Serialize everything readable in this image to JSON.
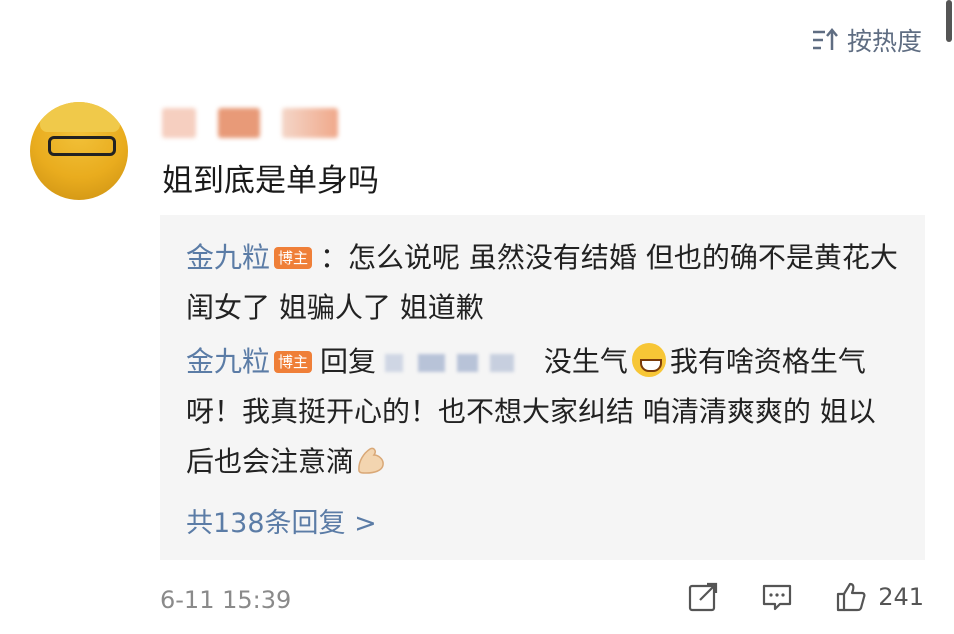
{
  "sort": {
    "label": "按热度"
  },
  "comment": {
    "text": "姐到底是单身吗",
    "time": "6-11 15:39",
    "likes": "241"
  },
  "replies": [
    {
      "author": "金九粒",
      "badge": "博主",
      "text_a": "：怎么说呢 虽然没有结婚 但也的确不是黄花大闺女了 姐骗人了 姐道歉"
    },
    {
      "author": "金九粒",
      "badge": "博主",
      "prefix": "回复",
      "text_a": "没生气",
      "text_b": "我有啥资格生气呀！我真挺开心的！也不想大家纠结 咱清清爽爽的 姐以后也会注意滴"
    }
  ],
  "more_replies": "共138条回复 >",
  "icons": {
    "sort": "sort-icon",
    "share": "share-icon",
    "comment": "comment-icon",
    "like": "thumbs-up-icon"
  }
}
